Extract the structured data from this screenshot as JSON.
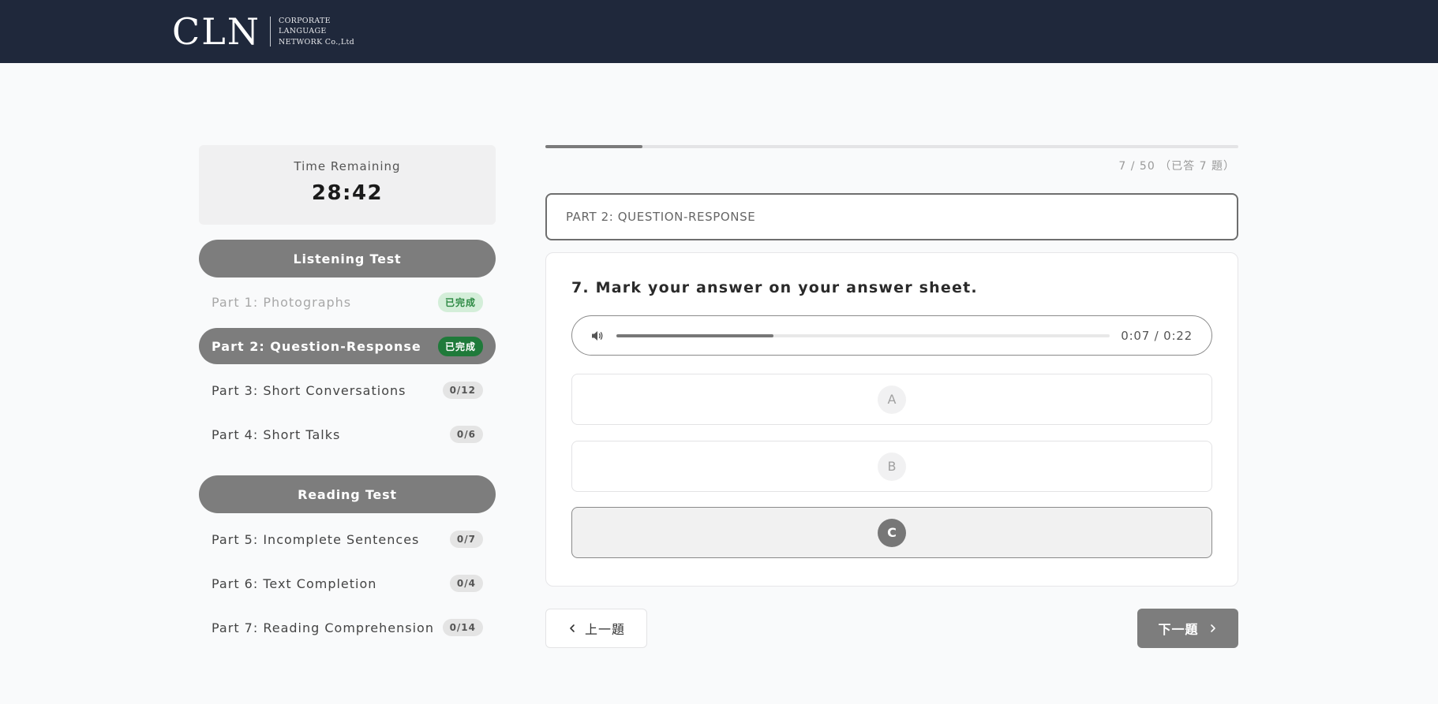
{
  "header": {
    "logo_mark": "CLN",
    "logo_lines": [
      "CORPORATE",
      "LANGUAGE",
      "NETWORK Co.,Ltd"
    ]
  },
  "sidebar": {
    "timer_label": "Time Remaining",
    "timer_value": "28:42",
    "listening": {
      "title": "Listening Test",
      "parts": [
        {
          "label": "Part 1: Photographs",
          "badge": "已完成"
        },
        {
          "label": "Part 2: Question-Response",
          "badge": "已完成"
        },
        {
          "label": "Part 3: Short Conversations",
          "badge": "0/12"
        },
        {
          "label": "Part 4: Short Talks",
          "badge": "0/6"
        }
      ]
    },
    "reading": {
      "title": "Reading Test",
      "parts": [
        {
          "label": "Part 5: Incomplete Sentences",
          "badge": "0/7"
        },
        {
          "label": "Part 6: Text Completion",
          "badge": "0/4"
        },
        {
          "label": "Part 7: Reading Comprehension",
          "badge": "0/14"
        }
      ]
    }
  },
  "main": {
    "progress": {
      "answered": 7,
      "total": 50,
      "text": "7 / 50 （已答 7 題）"
    },
    "part_header": "PART 2: QUESTION-RESPONSE",
    "question": {
      "title": "7. Mark your answer on your answer sheet.",
      "audio": {
        "current": "0:07",
        "duration": "0:22",
        "time_text": "0:07 / 0:22",
        "progress": 0.3182
      },
      "options": [
        "A",
        "B",
        "C"
      ],
      "selected": "C"
    },
    "nav": {
      "prev_label": "上一題",
      "next_label": "下一題"
    }
  },
  "colors": {
    "header_bg": "#1f283b",
    "accent_gray": "#7d7d7d",
    "done_green": "#1f7a3a",
    "done_green_light": "#d4eed9"
  }
}
